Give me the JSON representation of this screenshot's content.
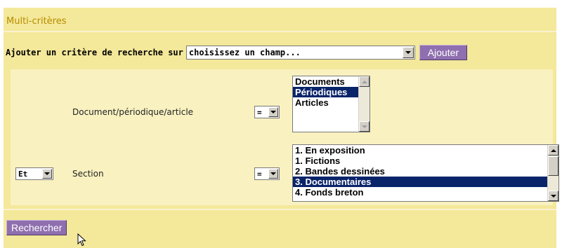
{
  "panel": {
    "title": "Multi-critères",
    "colors": {
      "panel_bg": "#f4e89a",
      "criteria_bg": "#f9f1c0",
      "title": "#b58d00",
      "button": "#8f6faf",
      "selection": "#0a246a"
    }
  },
  "add_criterion": {
    "label": "Ajouter un critère de recherche sur",
    "field_select_value": "choisissez un champ...",
    "button_label": "Ajouter"
  },
  "criteria": [
    {
      "connector": "",
      "field_label": "Document/périodique/article",
      "operator": "=",
      "options": [
        {
          "label": "Documents",
          "selected": false
        },
        {
          "label": "Périodiques",
          "selected": true
        },
        {
          "label": "Articles",
          "selected": false
        }
      ]
    },
    {
      "connector": "Et",
      "field_label": "Section",
      "operator": "=",
      "options": [
        {
          "label": "1. En exposition",
          "selected": false
        },
        {
          "label": "1. Fictions",
          "selected": false
        },
        {
          "label": "2. Bandes dessinées",
          "selected": false
        },
        {
          "label": "3. Documentaires",
          "selected": true
        },
        {
          "label": "4. Fonds breton",
          "selected": false
        }
      ]
    }
  ],
  "search_button_label": "Rechercher"
}
